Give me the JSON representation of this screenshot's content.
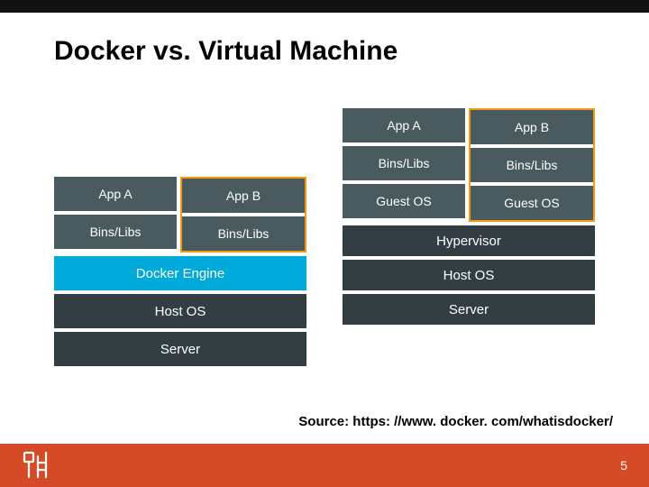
{
  "title": "Docker vs. Virtual Machine",
  "docker": {
    "columns": [
      {
        "app": "App A",
        "bins": "Bins/Libs"
      },
      {
        "app": "App B",
        "bins": "Bins/Libs"
      }
    ],
    "engine": "Docker Engine",
    "host_os": "Host OS",
    "server": "Server"
  },
  "vm": {
    "columns": [
      {
        "app": "App A",
        "bins": "Bins/Libs",
        "guest": "Guest OS"
      },
      {
        "app": "App B",
        "bins": "Bins/Libs",
        "guest": "Guest OS"
      }
    ],
    "hypervisor": "Hypervisor",
    "host_os": "Host OS",
    "server": "Server"
  },
  "source": "Source: https: //www. docker. com/whatisdocker/",
  "page_number": "5",
  "colors": {
    "accent_orange": "#d64b27",
    "highlight_border": "#f39c12",
    "docker_blue": "#00aada",
    "block_gray": "#4a5b5f",
    "block_dark": "#333e42"
  }
}
